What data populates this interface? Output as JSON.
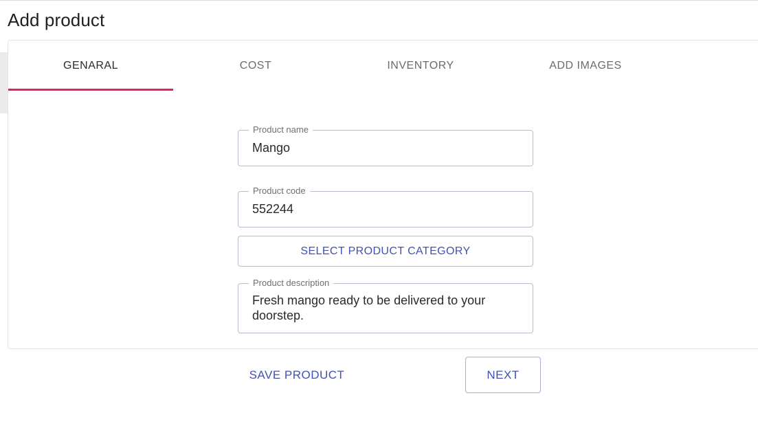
{
  "page": {
    "title": "Add product"
  },
  "tabs": [
    {
      "label": "GENARAL",
      "active": true
    },
    {
      "label": "COST",
      "active": false
    },
    {
      "label": "INVENTORY",
      "active": false
    },
    {
      "label": "ADD IMAGES",
      "active": false
    }
  ],
  "form": {
    "product_name": {
      "label": "Product name",
      "value": "Mango"
    },
    "product_code": {
      "label": "Product code",
      "value": "552244"
    },
    "category_button": "SELECT PRODUCT CATEGORY",
    "product_description": {
      "label": "Product description",
      "value": "Fresh mango ready to be delivered to your doorstep."
    }
  },
  "actions": {
    "save_label": "SAVE PRODUCT",
    "next_label": "NEXT"
  },
  "colors": {
    "accent": "#e91e63",
    "primary": "#3f51b5"
  }
}
